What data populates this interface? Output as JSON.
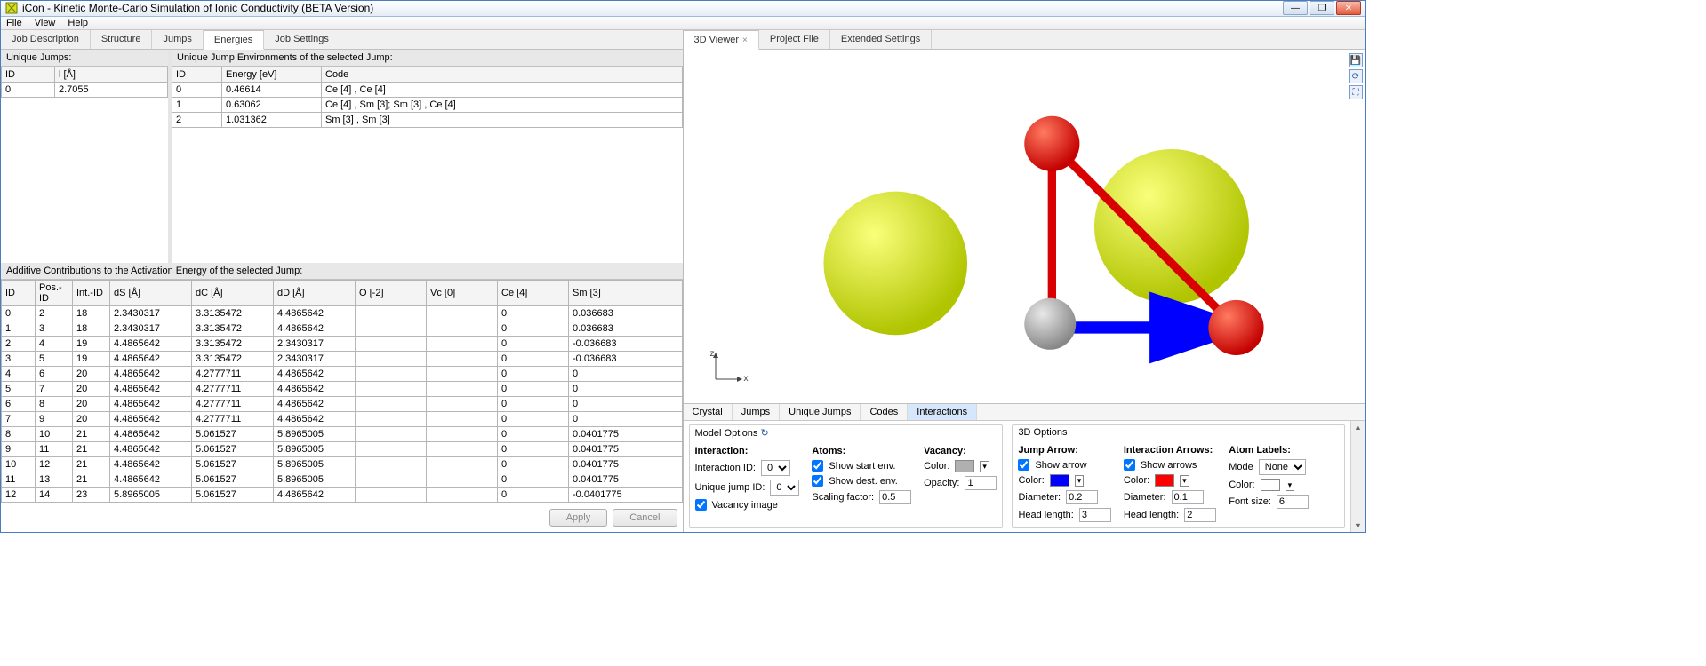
{
  "window": {
    "title": "iCon - Kinetic Monte-Carlo Simulation of Ionic Conductivity (BETA Version)"
  },
  "menubar": {
    "file": "File",
    "view": "View",
    "help": "Help"
  },
  "left_tabs": {
    "job_description": "Job Description",
    "structure": "Structure",
    "jumps": "Jumps",
    "energies": "Energies",
    "job_settings": "Job Settings"
  },
  "unique_jumps": {
    "header": "Unique Jumps:",
    "col_id": "ID",
    "col_l": "l [Å]",
    "rows": [
      {
        "id": "0",
        "l": "2.7055"
      }
    ]
  },
  "jump_env": {
    "header": "Unique Jump Environments of the selected Jump:",
    "col_id": "ID",
    "col_energy": "Energy [eV]",
    "col_code": "Code",
    "rows": [
      {
        "id": "0",
        "energy": "0.46614",
        "code": "Ce [4] , Ce [4]"
      },
      {
        "id": "1",
        "energy": "0.63062",
        "code": "Ce [4] , Sm [3]; Sm [3] , Ce [4]"
      },
      {
        "id": "2",
        "energy": "1.031362",
        "code": "Sm [3] , Sm [3]"
      }
    ]
  },
  "additive": {
    "header": "Additive Contributions to the Activation Energy of the selected Jump:",
    "cols": {
      "id": "ID",
      "posid": "Pos.-ID",
      "intid": "Int.-ID",
      "ds": "dS [Å]",
      "dc": "dC [Å]",
      "dd": "dD [Å]",
      "o": "O [-2]",
      "vc": "Vc [0]",
      "ce": "Ce [4]",
      "sm": "Sm [3]"
    },
    "rows": [
      {
        "id": "0",
        "pos": "2",
        "int": "18",
        "ds": "2.3430317",
        "dc": "3.3135472",
        "dd": "4.4865642",
        "o": "",
        "vc": "",
        "ce": "0",
        "sm": "0.036683"
      },
      {
        "id": "1",
        "pos": "3",
        "int": "18",
        "ds": "2.3430317",
        "dc": "3.3135472",
        "dd": "4.4865642",
        "o": "",
        "vc": "",
        "ce": "0",
        "sm": "0.036683"
      },
      {
        "id": "2",
        "pos": "4",
        "int": "19",
        "ds": "4.4865642",
        "dc": "3.3135472",
        "dd": "2.3430317",
        "o": "",
        "vc": "",
        "ce": "0",
        "sm": "-0.036683"
      },
      {
        "id": "3",
        "pos": "5",
        "int": "19",
        "ds": "4.4865642",
        "dc": "3.3135472",
        "dd": "2.3430317",
        "o": "",
        "vc": "",
        "ce": "0",
        "sm": "-0.036683"
      },
      {
        "id": "4",
        "pos": "6",
        "int": "20",
        "ds": "4.4865642",
        "dc": "4.2777711",
        "dd": "4.4865642",
        "o": "",
        "vc": "",
        "ce": "0",
        "sm": "0"
      },
      {
        "id": "5",
        "pos": "7",
        "int": "20",
        "ds": "4.4865642",
        "dc": "4.2777711",
        "dd": "4.4865642",
        "o": "",
        "vc": "",
        "ce": "0",
        "sm": "0"
      },
      {
        "id": "6",
        "pos": "8",
        "int": "20",
        "ds": "4.4865642",
        "dc": "4.2777711",
        "dd": "4.4865642",
        "o": "",
        "vc": "",
        "ce": "0",
        "sm": "0"
      },
      {
        "id": "7",
        "pos": "9",
        "int": "20",
        "ds": "4.4865642",
        "dc": "4.2777711",
        "dd": "4.4865642",
        "o": "",
        "vc": "",
        "ce": "0",
        "sm": "0"
      },
      {
        "id": "8",
        "pos": "10",
        "int": "21",
        "ds": "4.4865642",
        "dc": "5.061527",
        "dd": "5.8965005",
        "o": "",
        "vc": "",
        "ce": "0",
        "sm": "0.0401775"
      },
      {
        "id": "9",
        "pos": "11",
        "int": "21",
        "ds": "4.4865642",
        "dc": "5.061527",
        "dd": "5.8965005",
        "o": "",
        "vc": "",
        "ce": "0",
        "sm": "0.0401775"
      },
      {
        "id": "10",
        "pos": "12",
        "int": "21",
        "ds": "4.4865642",
        "dc": "5.061527",
        "dd": "5.8965005",
        "o": "",
        "vc": "",
        "ce": "0",
        "sm": "0.0401775"
      },
      {
        "id": "11",
        "pos": "13",
        "int": "21",
        "ds": "4.4865642",
        "dc": "5.061527",
        "dd": "5.8965005",
        "o": "",
        "vc": "",
        "ce": "0",
        "sm": "0.0401775"
      },
      {
        "id": "12",
        "pos": "14",
        "int": "23",
        "ds": "5.8965005",
        "dc": "5.061527",
        "dd": "4.4865642",
        "o": "",
        "vc": "",
        "ce": "0",
        "sm": "-0.0401775"
      }
    ]
  },
  "buttons": {
    "apply": "Apply",
    "cancel": "Cancel"
  },
  "right_tabs": {
    "viewer": "3D Viewer",
    "project": "Project File",
    "extended": "Extended Settings"
  },
  "bottom_tabs": {
    "crystal": "Crystal",
    "jumps": "Jumps",
    "unique": "Unique Jumps",
    "codes": "Codes",
    "interactions": "Interactions"
  },
  "model_options": {
    "group_title": "Model Options",
    "interaction": "Interaction:",
    "interaction_id": "Interaction ID:",
    "interaction_id_val": "0",
    "unique_jump_id": "Unique jump ID:",
    "unique_jump_id_val": "0",
    "vacancy_image": "Vacancy image",
    "atoms": "Atoms:",
    "show_start": "Show start env.",
    "show_dest": "Show dest. env.",
    "scaling": "Scaling factor:",
    "scaling_val": "0.5",
    "vacancy": "Vacancy:",
    "color": "Color:",
    "opacity": "Opacity:",
    "opacity_val": "1"
  },
  "three_d_options": {
    "group_title": "3D Options",
    "jump_arrow": "Jump Arrow:",
    "show_arrow": "Show arrow",
    "color": "Color:",
    "diameter": "Diameter:",
    "jump_diam_val": "0.2",
    "head_length": "Head length:",
    "jump_head_val": "3",
    "interaction_arrows": "Interaction Arrows:",
    "show_arrows": "Show arrows",
    "int_diam_val": "0.1",
    "int_head_val": "2",
    "atom_labels": "Atom Labels:",
    "mode": "Mode",
    "mode_val": "None",
    "label_color": "Color:",
    "font_size": "Font size:",
    "font_size_val": "6"
  },
  "colors": {
    "vacancy": "#b0b0b0",
    "jump_arrow": "#0000ff",
    "int_arrow": "#ff0000",
    "label": "#ffffff"
  },
  "axes": {
    "x": "x",
    "z": "z"
  }
}
